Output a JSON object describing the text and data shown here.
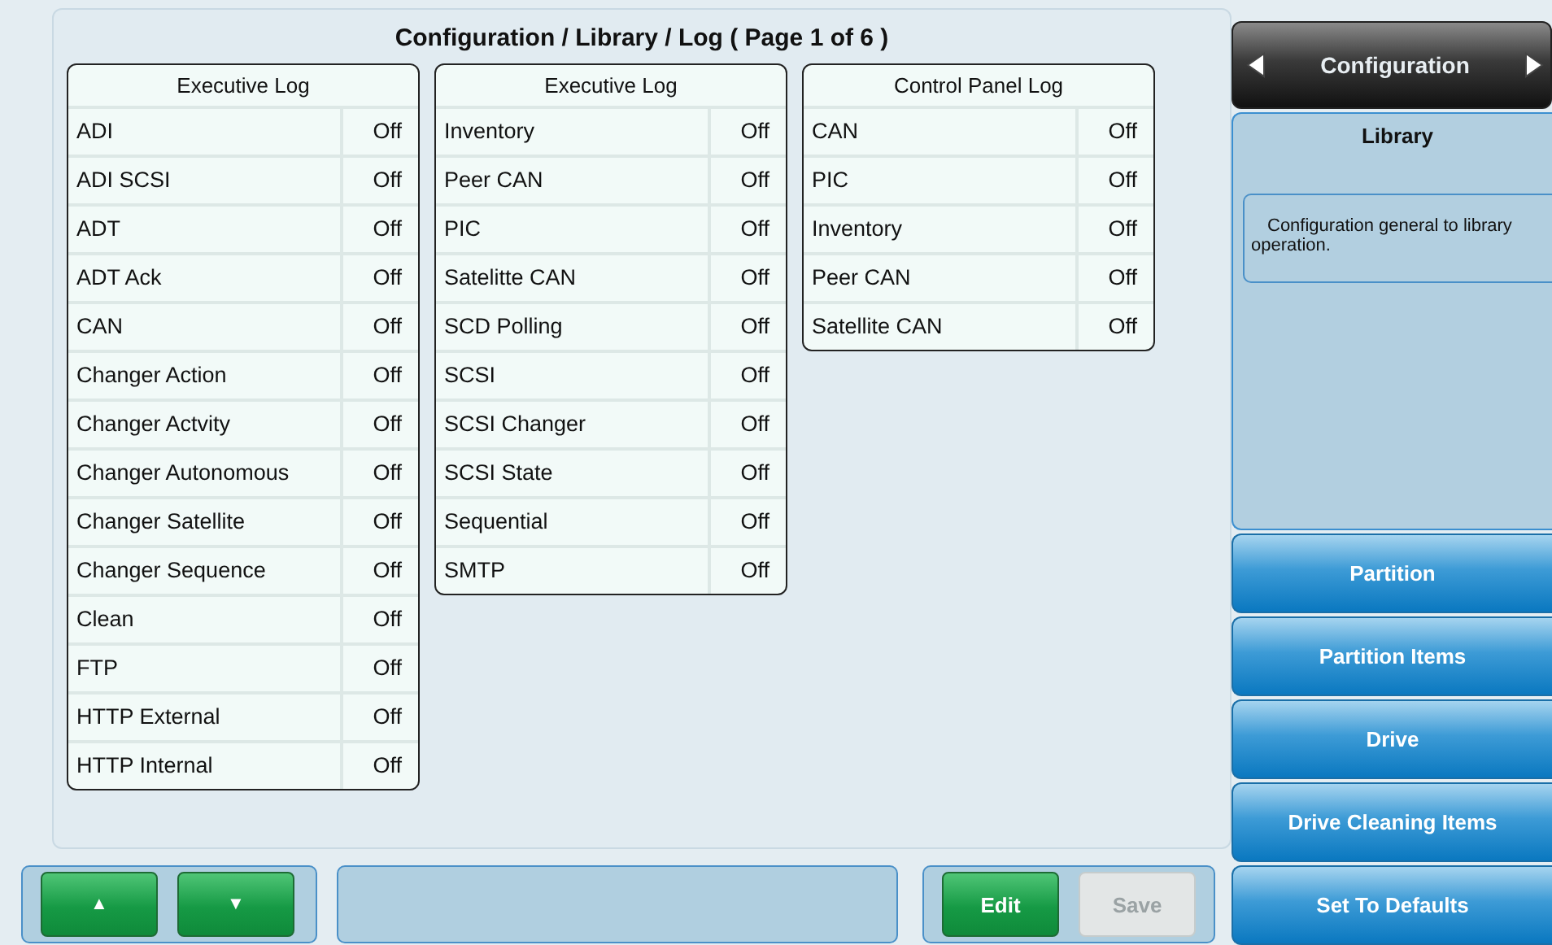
{
  "title": "Configuration / Library / Log ( Page 1 of 6 )",
  "tables": [
    {
      "heading": "Executive Log",
      "rows": [
        {
          "name": "ADI",
          "value": "Off"
        },
        {
          "name": "ADI SCSI",
          "value": "Off"
        },
        {
          "name": "ADT",
          "value": "Off"
        },
        {
          "name": "ADT Ack",
          "value": "Off"
        },
        {
          "name": "CAN",
          "value": "Off"
        },
        {
          "name": "Changer Action",
          "value": "Off"
        },
        {
          "name": "Changer Actvity",
          "value": "Off"
        },
        {
          "name": "Changer Autonomous",
          "value": "Off"
        },
        {
          "name": "Changer Satellite",
          "value": "Off"
        },
        {
          "name": "Changer Sequence",
          "value": "Off"
        },
        {
          "name": "Clean",
          "value": "Off"
        },
        {
          "name": "FTP",
          "value": "Off"
        },
        {
          "name": "HTTP External",
          "value": "Off"
        },
        {
          "name": "HTTP Internal",
          "value": "Off"
        }
      ]
    },
    {
      "heading": "Executive Log",
      "rows": [
        {
          "name": "Inventory",
          "value": "Off"
        },
        {
          "name": "Peer CAN",
          "value": "Off"
        },
        {
          "name": "PIC",
          "value": "Off"
        },
        {
          "name": "Satelitte CAN",
          "value": "Off"
        },
        {
          "name": "SCD Polling",
          "value": "Off"
        },
        {
          "name": "SCSI",
          "value": "Off"
        },
        {
          "name": "SCSI Changer",
          "value": "Off"
        },
        {
          "name": "SCSI State",
          "value": "Off"
        },
        {
          "name": "Sequential",
          "value": "Off"
        },
        {
          "name": "SMTP",
          "value": "Off"
        }
      ]
    },
    {
      "heading": "Control Panel Log",
      "rows": [
        {
          "name": "CAN",
          "value": "Off"
        },
        {
          "name": "PIC",
          "value": "Off"
        },
        {
          "name": "Inventory",
          "value": "Off"
        },
        {
          "name": "Peer CAN",
          "value": "Off"
        },
        {
          "name": "Satellite CAN",
          "value": "Off"
        }
      ]
    }
  ],
  "sidebar": {
    "header": "Configuration",
    "current": {
      "title": "Library",
      "description": "Configuration general to library operation."
    },
    "items": [
      "Partition",
      "Partition Items",
      "Drive",
      "Drive Cleaning Items",
      "Set To Defaults"
    ]
  },
  "scroll_buttons": [
    "▲",
    "▼"
  ],
  "actions": [
    {
      "label": "Edit",
      "disabled": false
    },
    {
      "label": "Save",
      "disabled": true
    }
  ]
}
